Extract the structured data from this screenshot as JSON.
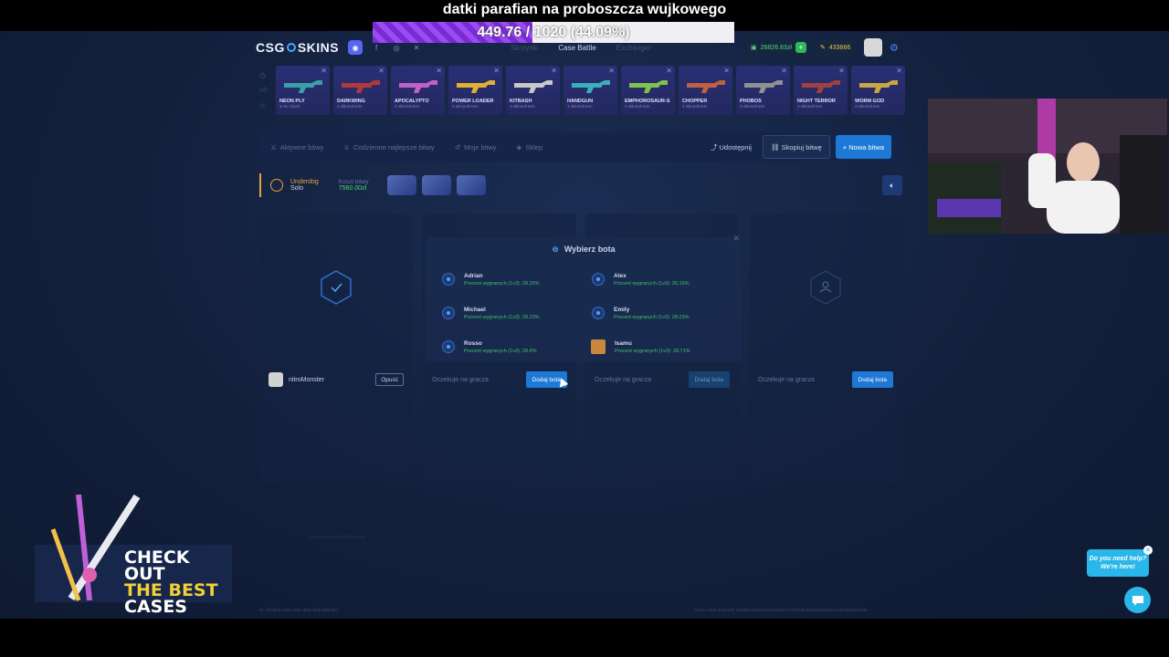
{
  "stream": {
    "donation_title": "datki parafian na proboszcza wujkowego",
    "goal_text": "449.76 / 1020 (44.09%)",
    "goal_progress": 0.4409,
    "promo": {
      "line1": "CHECK OUT",
      "line2": "THE BEST",
      "line3": "CASES"
    },
    "help_bubble": {
      "line1": "Do you need help?",
      "line2": "We're here!"
    }
  },
  "header": {
    "logo_left": "CSG",
    "logo_right": "SKINS",
    "nav": [
      "Skrzynki",
      "Case Battle",
      "Exchanger"
    ],
    "active_nav": "Case Battle",
    "balance": "26826.83zł",
    "coins": "433866"
  },
  "cases": [
    {
      "name": "NEON PLY",
      "sub": "w 9x 13nzb",
      "color": "#3aa0a8"
    },
    {
      "name": "DARKWING",
      "sub": "2 skłonali tem",
      "color": "#b03a3a"
    },
    {
      "name": "APOCALYPTO",
      "sub": "2 skłonali tem",
      "color": "#c060c8"
    },
    {
      "name": "POWER LOADER",
      "sub": "3 skrzynki tem",
      "color": "#e0b030"
    },
    {
      "name": "KITBASH",
      "sub": "3 skłonali tem",
      "color": "#c8c8c8"
    },
    {
      "name": "HANDGUN",
      "sub": "3 skłonali tem",
      "color": "#3ab0b8"
    },
    {
      "name": "EMPHOROSAUR-S",
      "sub": "3 skłonali tem",
      "color": "#7cc44a"
    },
    {
      "name": "CHOPPER",
      "sub": "3 skłonali tem",
      "color": "#c06040"
    },
    {
      "name": "PHOBOS",
      "sub": "3 skłonali tem",
      "color": "#909090"
    },
    {
      "name": "NIGHT TERROR",
      "sub": "3 skłonali tem",
      "color": "#a04040"
    },
    {
      "name": "WORM GOD",
      "sub": "3 skłonali tem",
      "color": "#c8a840"
    }
  ],
  "tabs": {
    "items": [
      "Aktywne bitwy",
      "Codzienne najlepsze bitwy",
      "Moje bitwy",
      "Sklep"
    ],
    "share": "Udostępnij",
    "copy": "Skopiuj bitwę",
    "new": "+ Nowa bitwa"
  },
  "battle": {
    "mode": "Underdog",
    "type": "Solo",
    "cost_label": "Koszt bitwy",
    "cost_value": "7560.00zł"
  },
  "players": {
    "player1": "nitroMonster",
    "leave": "Opuść",
    "waiting": "Oczekuje na gracza",
    "add_bot": "Dodaj bota"
  },
  "modal": {
    "title": "Wybierz bota",
    "bots": [
      {
        "name": "Adrian",
        "rate": "Procent wygranych (1v3): 28.25%"
      },
      {
        "name": "Alex",
        "rate": "Procent wygranych (1v3): 26.16%"
      },
      {
        "name": "Michael",
        "rate": "Procent wygranych (1v3): 28.23%"
      },
      {
        "name": "Emily",
        "rate": "Procent wygranych (1v3): 28.23%"
      },
      {
        "name": "Rosso",
        "rate": "Procent wygranych (1v3): 28.4%"
      },
      {
        "name": "Isamu",
        "rate": "Procent wygranych (1v3): 28.71%"
      }
    ]
  },
  "footer": {
    "left": "ID: df43b6b-e3c5-4b9e-9e5c-8d4ca8f90847",
    "right": "Server seed (hashed): 0e53bac2fad4d14a4c6d7137c7b97db9f4f3b3bc033e1e3ae49a4c87feab",
    "watermark": "Zarezerwuj miejsce/drużyny"
  },
  "colors": {
    "accent": "#1e78d6",
    "success": "#4fd47a",
    "gold": "#e5a23a",
    "goal_fill": "#7a2bd6"
  }
}
